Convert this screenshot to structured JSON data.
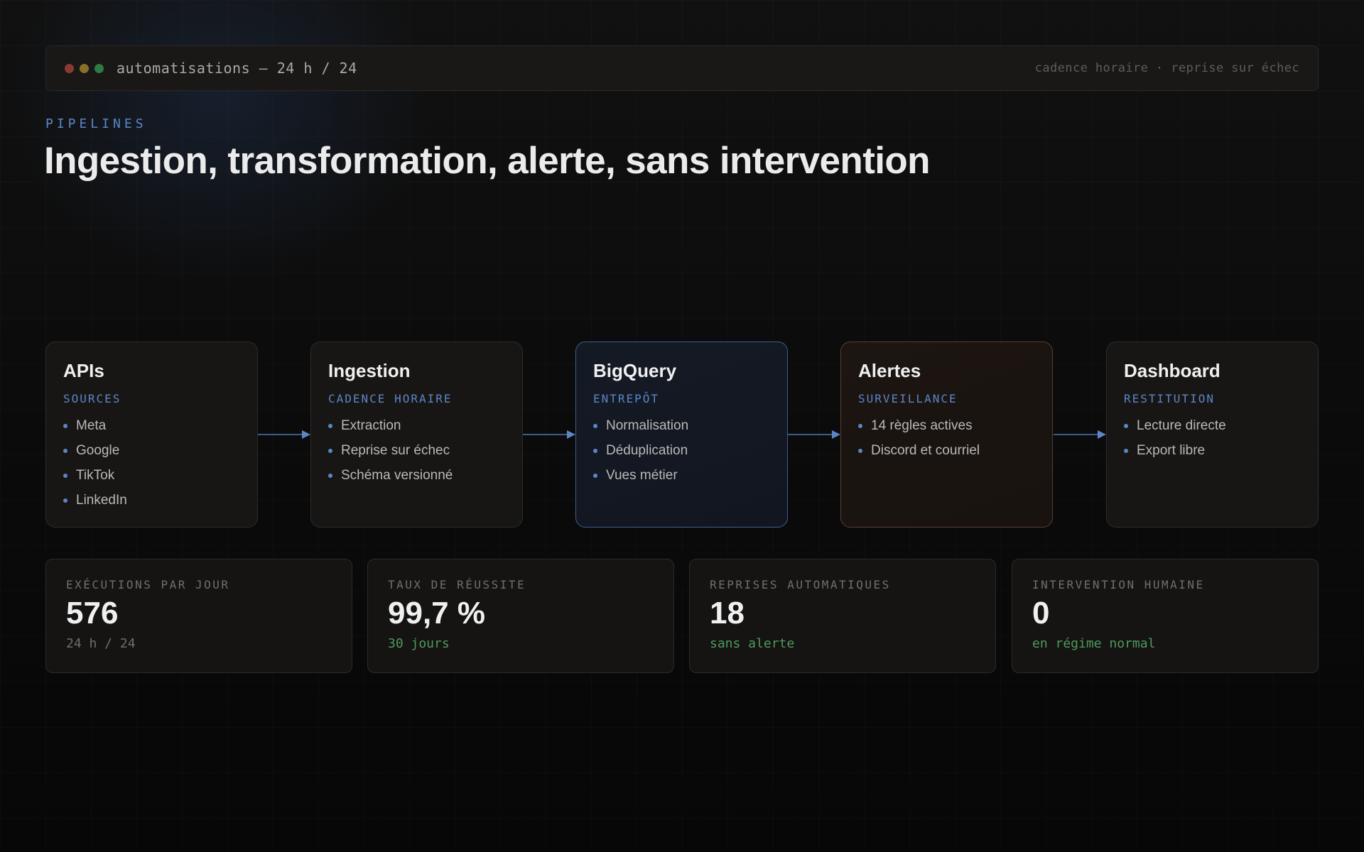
{
  "window": {
    "title": "automatisations — 24 h / 24",
    "meta": "cadence horaire · reprise sur échec"
  },
  "header": {
    "eyebrow": "PIPELINES",
    "title": "Ingestion, transformation, alerte, sans intervention"
  },
  "pipeline": {
    "stages": [
      {
        "title": "APIs",
        "subtitle": "SOURCES",
        "items": [
          "Meta",
          "Google",
          "TikTok",
          "LinkedIn"
        ]
      },
      {
        "title": "Ingestion",
        "subtitle": "CADENCE HORAIRE",
        "items": [
          "Extraction",
          "Reprise sur échec",
          "Schéma versionné"
        ]
      },
      {
        "title": "BigQuery",
        "subtitle": "ENTREPÔT",
        "items": [
          "Normalisation",
          "Déduplication",
          "Vues métier"
        ]
      },
      {
        "title": "Alertes",
        "subtitle": "SURVEILLANCE",
        "items": [
          "14 règles actives",
          "Discord et courriel"
        ]
      },
      {
        "title": "Dashboard",
        "subtitle": "RESTITUTION",
        "items": [
          "Lecture directe",
          "Export libre"
        ]
      }
    ]
  },
  "stats": [
    {
      "label": "EXÉCUTIONS PAR JOUR",
      "value": "576",
      "note": "24 h / 24"
    },
    {
      "label": "TAUX DE RÉUSSITE",
      "value": "99,7 %",
      "note": "30 jours"
    },
    {
      "label": "REPRISES AUTOMATIQUES",
      "value": "18",
      "note": "sans alerte"
    },
    {
      "label": "INTERVENTION HUMAINE",
      "value": "0",
      "note": "en régime normal"
    }
  ],
  "colors": {
    "accent": "#5b86c7",
    "success": "#4d9b5c",
    "warning_border": "#5c3e2f"
  }
}
